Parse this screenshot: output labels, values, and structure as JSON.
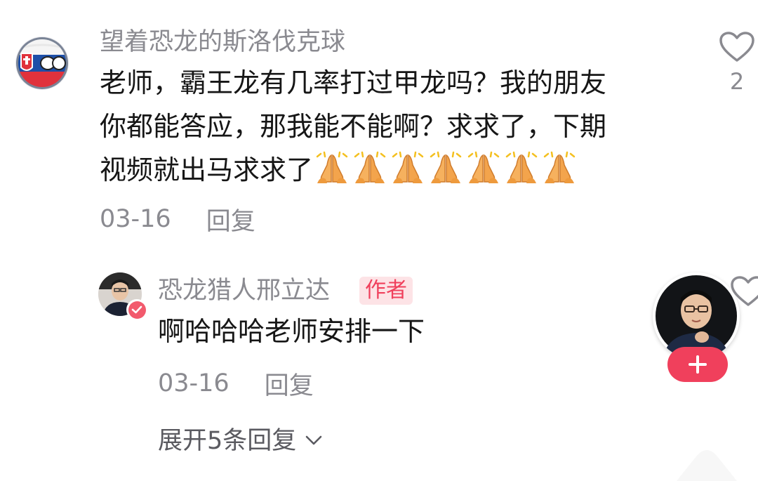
{
  "comment": {
    "username": "望着恐龙的斯洛伐克球",
    "text_lines": [
      "老师，霸王龙有几率打过甲龙吗？我的朋友",
      "你都能答应，那我能不能啊？求求了，下期",
      "视频就出马求求了"
    ],
    "emoji": "folded-hands-emoji",
    "emoji_count": 7,
    "date": "03-16",
    "reply_label": "回复",
    "like_count": "2"
  },
  "reply": {
    "username": "恐龙猎人邢立达",
    "author_badge": "作者",
    "text": "啊哈哈哈老师安排一下",
    "date": "03-16",
    "reply_label": "回复"
  },
  "expand_label": "展开5条回复",
  "colors": {
    "accent": "#f0405c",
    "badge_bg": "#fde3e6",
    "meta_text": "#8a8a90",
    "body_text": "#161616"
  }
}
